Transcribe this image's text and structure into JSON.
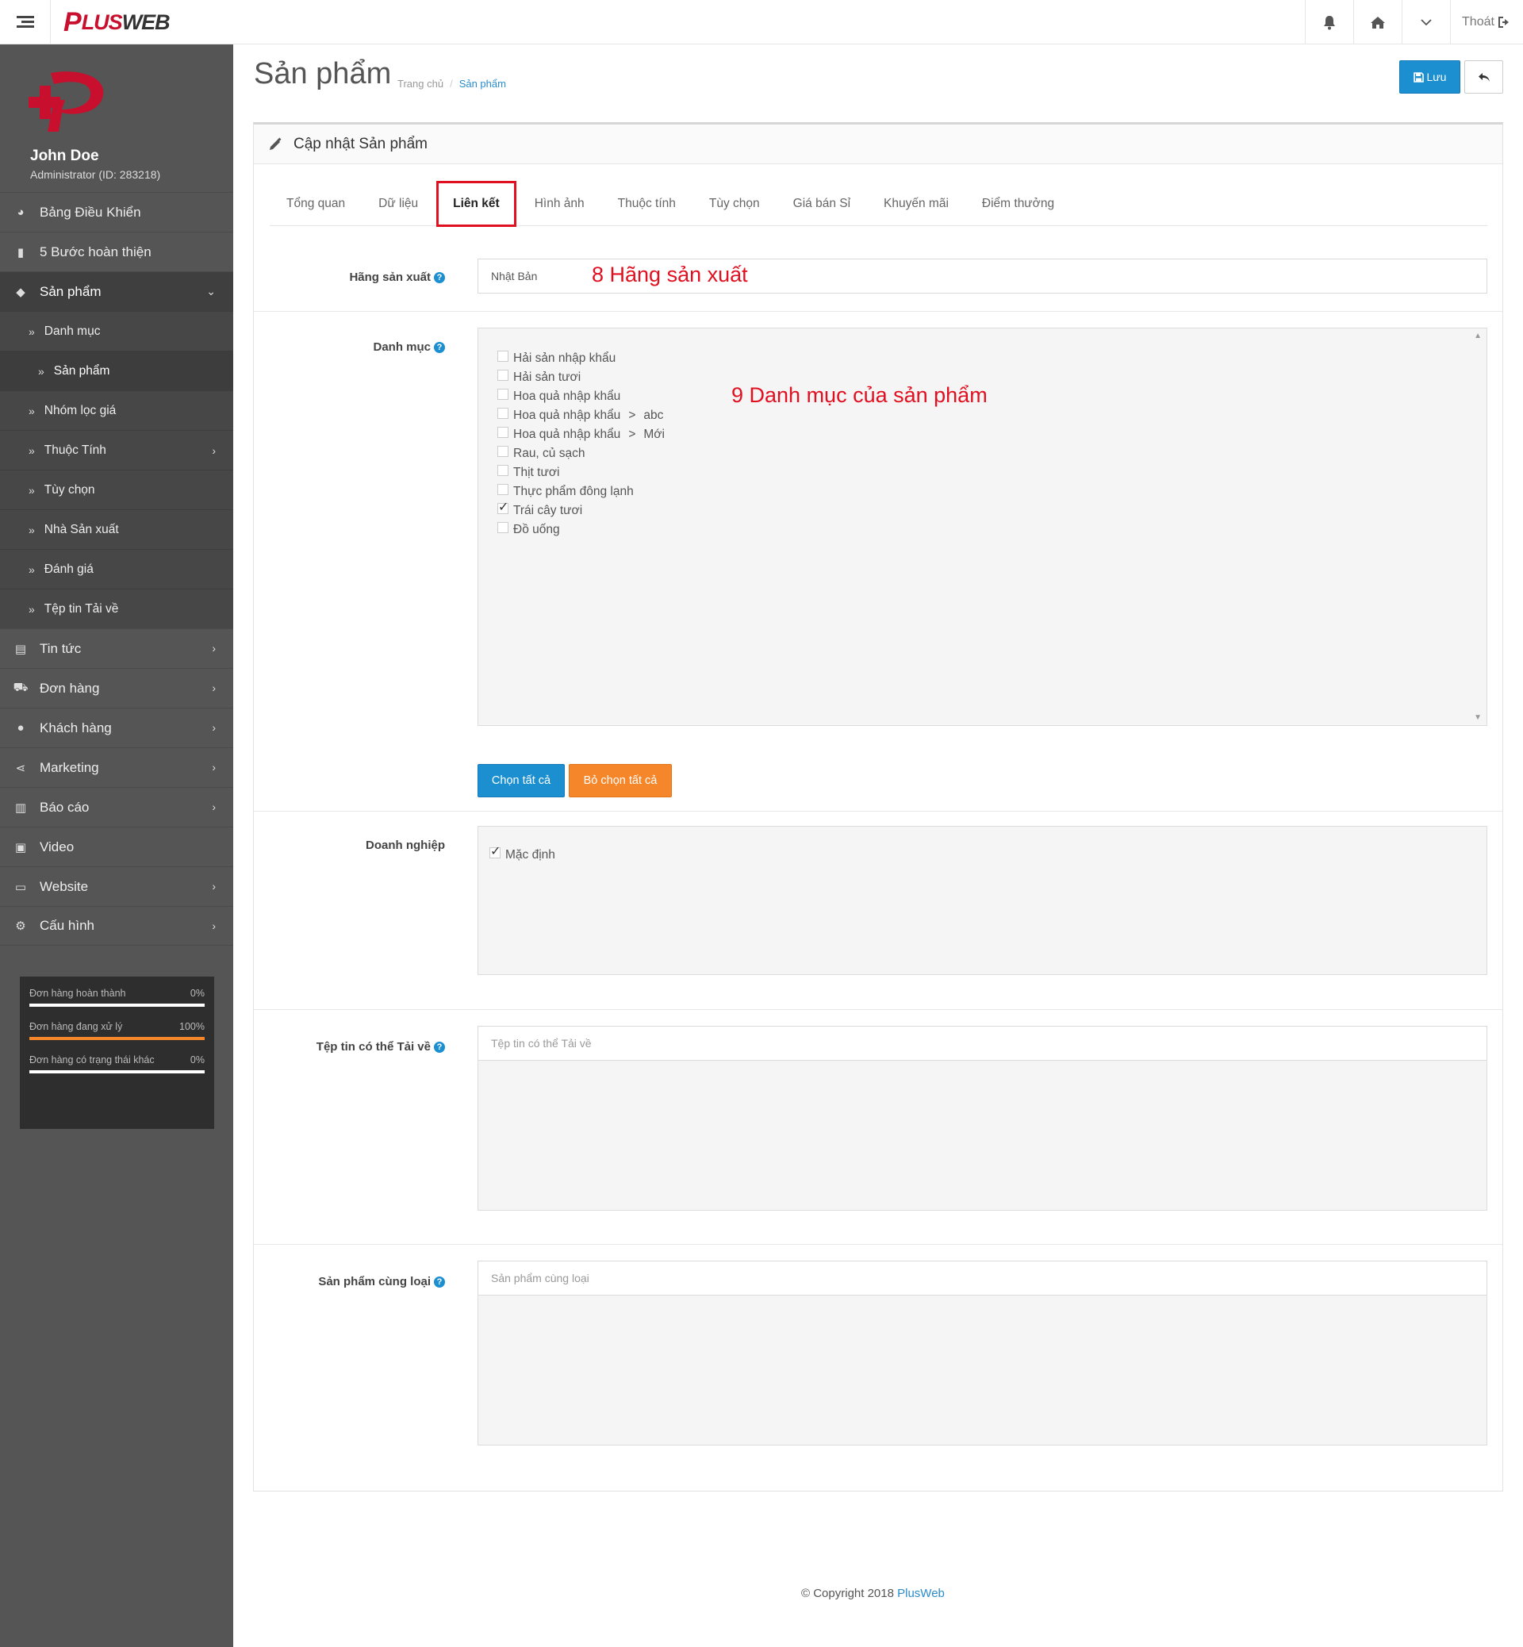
{
  "topbar": {
    "logo_plus": "P",
    "logo_word_a": "LUS",
    "logo_word_b": "WEB",
    "logout_label": "Thoát"
  },
  "profile": {
    "name": "John Doe",
    "role": "Administrator (ID: 283218)"
  },
  "sidebar": {
    "items": [
      {
        "label": "Bảng Điều Khiển",
        "icon": "dashboard-icon"
      },
      {
        "label": "5 Bước hoàn thiện",
        "icon": "book-icon"
      },
      {
        "label": "Sản phẩm",
        "icon": "tags-icon"
      },
      {
        "label": "Tin tức",
        "icon": "newspaper-icon"
      },
      {
        "label": "Đơn hàng",
        "icon": "cart-icon"
      },
      {
        "label": "Khách hàng",
        "icon": "user-icon"
      },
      {
        "label": "Marketing",
        "icon": "share-icon"
      },
      {
        "label": "Báo cáo",
        "icon": "bar-chart-icon"
      },
      {
        "label": "Video",
        "icon": "youtube-icon"
      },
      {
        "label": "Website",
        "icon": "monitor-icon"
      },
      {
        "label": "Cấu hình",
        "icon": "gear-icon"
      }
    ],
    "sub_items": [
      "Danh mục",
      "Sản phẩm",
      "Nhóm lọc giá",
      "Thuộc Tính",
      "Tùy chọn",
      "Nhà Sản xuất",
      "Đánh giá",
      "Tệp tin Tải về"
    ]
  },
  "stats": [
    {
      "label": "Đơn hàng hoàn thành",
      "value": "0%",
      "fraction": 0
    },
    {
      "label": "Đơn hàng đang xử lý",
      "value": "100%",
      "fraction": 1
    },
    {
      "label": "Đơn hàng có trạng thái khác",
      "value": "0%",
      "fraction": 0
    }
  ],
  "header": {
    "title": "Sản phẩm",
    "breadcrumb_home": "Trang chủ",
    "breadcrumb_sep": "/",
    "breadcrumb_current": "Sản phẩm",
    "save_label": "Lưu"
  },
  "panel": {
    "title": "Cập nhật Sản phẩm",
    "tabs": [
      "Tổng quan",
      "Dữ liệu",
      "Liên kết",
      "Hình ảnh",
      "Thuộc tính",
      "Tùy chọn",
      "Giá bán Sỉ",
      "Khuyến mãi",
      "Điểm thưởng"
    ],
    "active_tab": "Liên kết"
  },
  "form": {
    "manufacturer": {
      "label": "Hãng sản xuất",
      "value": "Nhật Bản",
      "annotation": "8 Hãng sản xuất"
    },
    "category": {
      "label": "Danh mục",
      "annotation": "9 Danh mục của sản phẩm",
      "options": [
        {
          "text": "Hải sản nhập khẩu",
          "checked": false
        },
        {
          "text": "Hải sản tươi",
          "checked": false
        },
        {
          "text": "Hoa quả nhập khẩu",
          "checked": false
        },
        {
          "text": "Hoa quả nhập khẩu",
          "suffix": "abc",
          "checked": false
        },
        {
          "text": "Hoa quả nhập khẩu",
          "suffix": "Mới",
          "checked": false
        },
        {
          "text": "Rau, củ sạch",
          "checked": false
        },
        {
          "text": "Thịt tươi",
          "checked": false
        },
        {
          "text": "Thực phẩm đông lạnh",
          "checked": false
        },
        {
          "text": "Trái cây tươi",
          "checked": true
        },
        {
          "text": "Đồ uống",
          "checked": false
        }
      ],
      "select_all": "Chọn tất cả",
      "deselect_all": "Bỏ chọn tất cả"
    },
    "business": {
      "label": "Doanh nghiệp",
      "option": "Mặc định",
      "checked": true
    },
    "downloads": {
      "label": "Tệp tin có thể Tải về",
      "placeholder": "Tệp tin có thể Tải về"
    },
    "related": {
      "label": "Sản phẩm cùng loại",
      "placeholder": "Sản phẩm cùng loại"
    }
  },
  "footer": {
    "copyright": "© Copyright 2018",
    "brand": "PlusWeb"
  }
}
